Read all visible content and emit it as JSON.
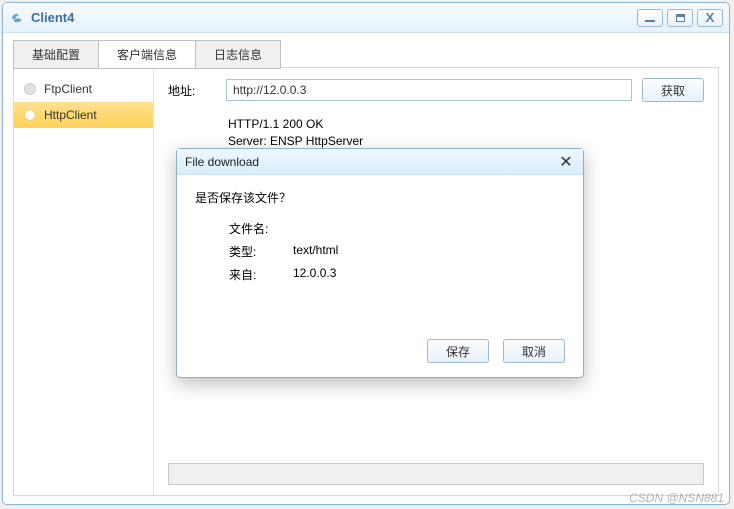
{
  "window": {
    "title": "Client4",
    "buttons": {
      "min": "",
      "max": "",
      "close": "X"
    }
  },
  "tabs": [
    "基础配置",
    "客户端信息",
    "日志信息"
  ],
  "activeTab": 1,
  "sidebar": {
    "items": [
      {
        "label": "FtpClient"
      },
      {
        "label": "HttpClient"
      }
    ],
    "activeIndex": 1
  },
  "address": {
    "label": "地址:",
    "value": "http://12.0.0.3",
    "fetch": "获取"
  },
  "response": "HTTP/1.1 200 OK\nServer: ENSP HttpServer\nAuth: HUAWEI",
  "dialog": {
    "title": "File download",
    "prompt": "是否保存该文件？",
    "rows": {
      "filename_k": "文件名:",
      "filename_v": "",
      "type_k": "类型:",
      "type_v": "text/html",
      "from_k": "来自:",
      "from_v": "12.0.0.3"
    },
    "save": "保存",
    "cancel": "取消"
  },
  "watermark": "CSDN @NSN881"
}
